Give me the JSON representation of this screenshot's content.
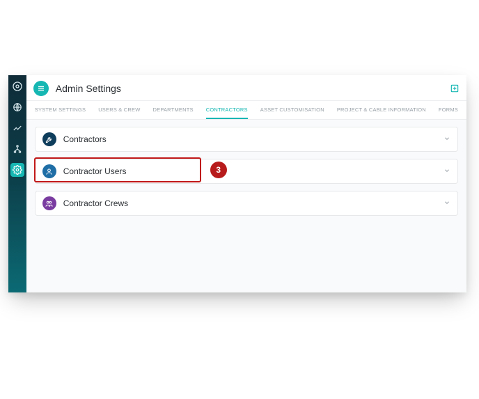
{
  "header": {
    "title": "Admin Settings"
  },
  "tabs": [
    {
      "label": "SYSTEM SETTINGS",
      "active": false
    },
    {
      "label": "USERS & CREW",
      "active": false
    },
    {
      "label": "DEPARTMENTS",
      "active": false
    },
    {
      "label": "CONTRACTORS",
      "active": true
    },
    {
      "label": "ASSET CUSTOMISATION",
      "active": false
    },
    {
      "label": "PROJECT & CABLE INFORMATION",
      "active": false
    },
    {
      "label": "FORMS",
      "active": false
    }
  ],
  "panels": [
    {
      "label": "Contractors",
      "icon": "wrench-icon",
      "iconClass": "navy"
    },
    {
      "label": "Contractor Users",
      "icon": "user-icon",
      "iconClass": "blue",
      "highlighted": true
    },
    {
      "label": "Contractor Crews",
      "icon": "crew-icon",
      "iconClass": "purple"
    }
  ],
  "annotation": {
    "step": "3"
  },
  "colors": {
    "accent": "#16b7b3",
    "annotation_red": "#b81b1b"
  }
}
